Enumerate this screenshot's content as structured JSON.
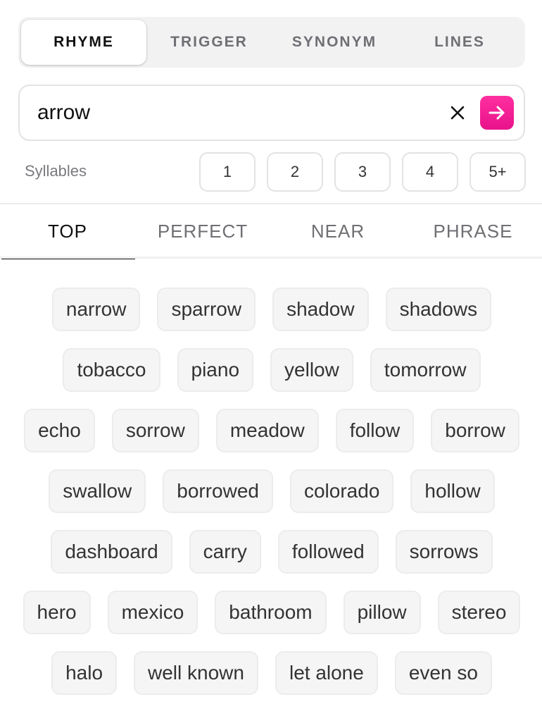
{
  "modes": [
    {
      "label": "RHYME",
      "active": true
    },
    {
      "label": "TRIGGER",
      "active": false
    },
    {
      "label": "SYNONYM",
      "active": false
    },
    {
      "label": "LINES",
      "active": false
    }
  ],
  "search": {
    "value": "arrow",
    "clear_icon": "close-icon",
    "go_icon": "arrow-right-icon",
    "accent_color": "#f0168f"
  },
  "syllables": {
    "label": "Syllables",
    "options": [
      "1",
      "2",
      "3",
      "4",
      "5+"
    ]
  },
  "result_tabs": [
    {
      "label": "TOP",
      "active": true
    },
    {
      "label": "PERFECT",
      "active": false
    },
    {
      "label": "NEAR",
      "active": false
    },
    {
      "label": "PHRASE",
      "active": false
    }
  ],
  "results": [
    [
      "narrow",
      "sparrow",
      "shadow",
      "shadows"
    ],
    [
      "tobacco",
      "piano",
      "yellow",
      "tomorrow"
    ],
    [
      "echo",
      "sorrow",
      "meadow",
      "follow",
      "borrow"
    ],
    [
      "swallow",
      "borrowed",
      "colorado",
      "hollow"
    ],
    [
      "dashboard",
      "carry",
      "followed",
      "sorrows"
    ],
    [
      "hero",
      "mexico",
      "bathroom",
      "pillow",
      "stereo"
    ],
    [
      "halo",
      "well known",
      "let alone",
      "even so"
    ]
  ]
}
